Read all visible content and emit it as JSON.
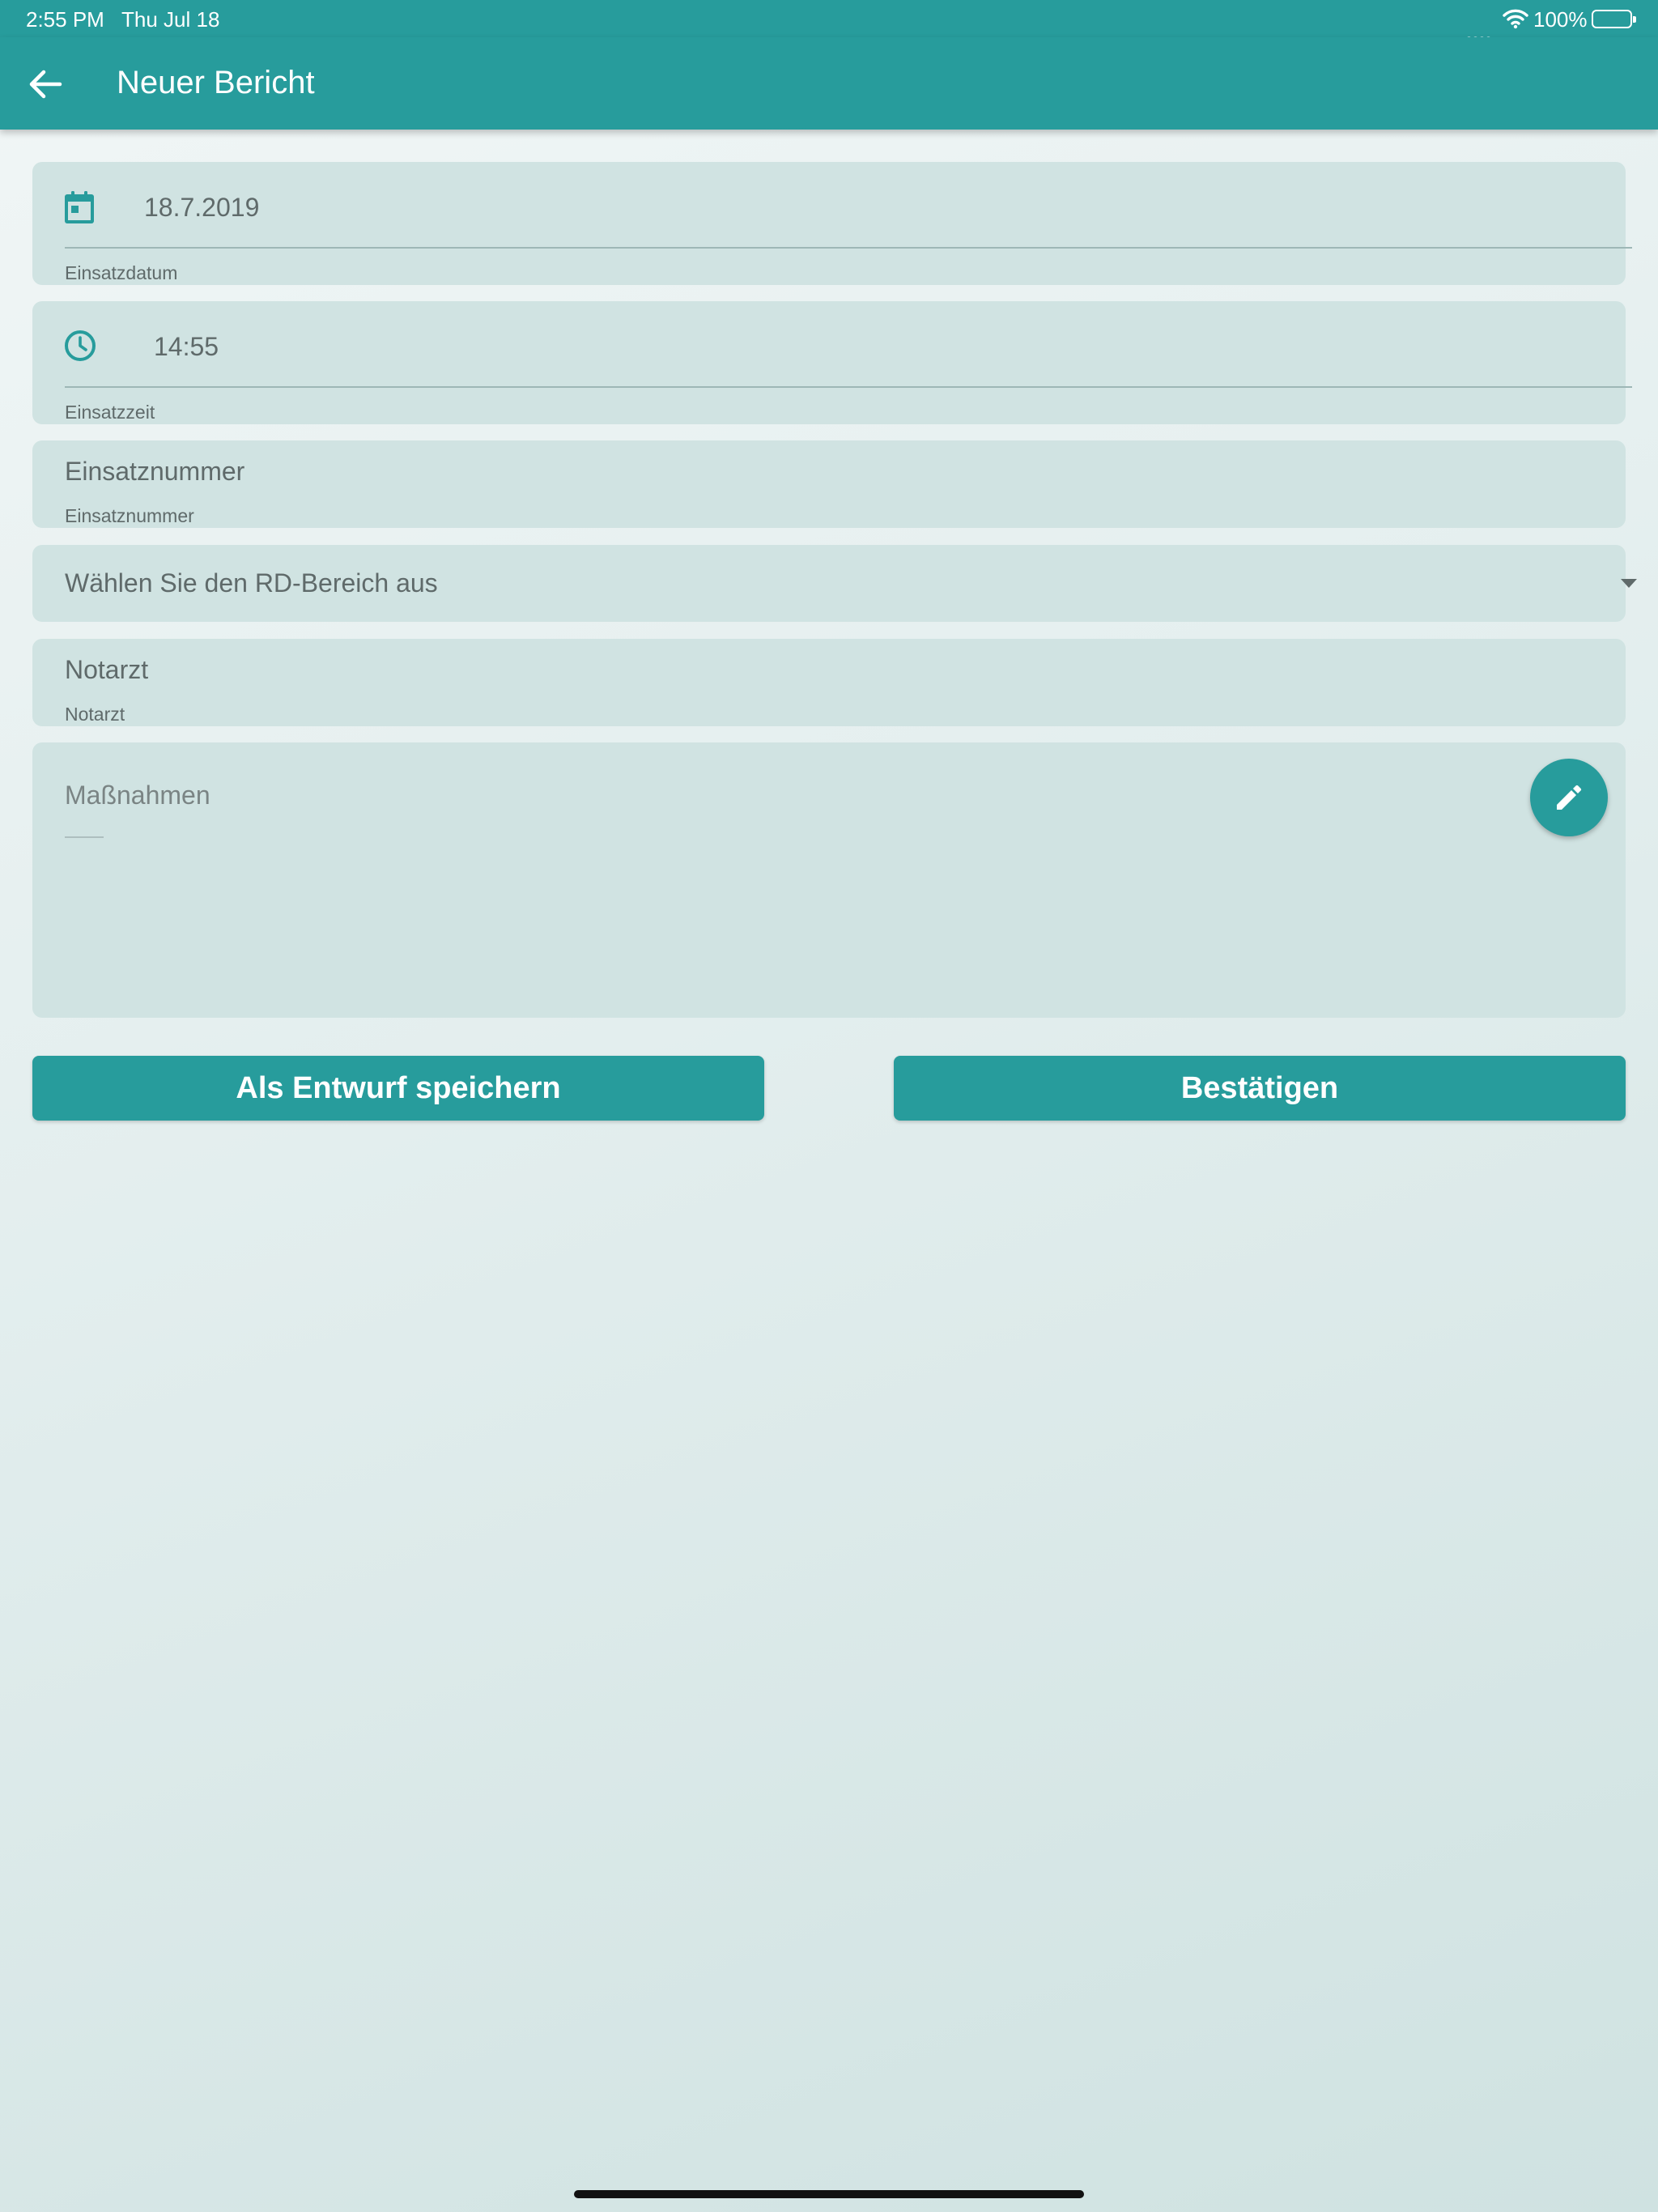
{
  "status_bar": {
    "time": "2:55 PM",
    "date": "Thu Jul 18",
    "battery": "100%"
  },
  "app_bar": {
    "title": "Neuer Bericht"
  },
  "form": {
    "date_field": {
      "value": "18.7.2019",
      "helper": "Einsatzdatum",
      "icon": "calendar-icon"
    },
    "time_field": {
      "value": "14:55",
      "helper": "Einsatzzeit",
      "icon": "clock-icon"
    },
    "number_field": {
      "placeholder": "Einsatznummer",
      "helper": "Einsatznummer"
    },
    "area_select": {
      "placeholder": "Wählen Sie den RD-Bereich aus"
    },
    "doctor_field": {
      "placeholder": "Notarzt",
      "helper": "Notarzt"
    },
    "measures_field": {
      "placeholder": "Maßnahmen",
      "edit_icon": "pencil-icon"
    }
  },
  "actions": {
    "draft_label": "Als Entwurf speichern",
    "confirm_label": "Bestätigen"
  },
  "colors": {
    "primary": "#279c9c",
    "field_bg": "#d0e3e2",
    "text_muted": "#5f6a6a"
  }
}
